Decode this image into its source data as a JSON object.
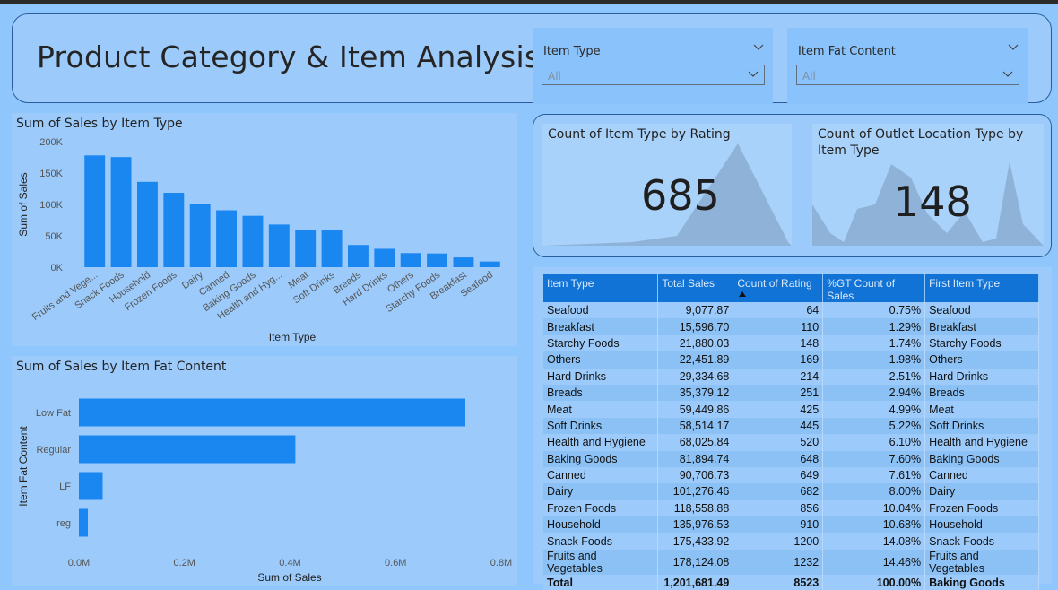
{
  "header": {
    "title": "Product Category & Item Analysis"
  },
  "slicers": [
    {
      "title": "Item Type",
      "value": "All"
    },
    {
      "title": "Item Fat Content",
      "value": "All"
    }
  ],
  "cards": [
    {
      "title": "Count of Item Type by Rating",
      "value": "685"
    },
    {
      "title": "Count of Outlet Location Type by Item Type",
      "value": "148"
    }
  ],
  "colors": {
    "bar": "#1a86f0",
    "background": "#8fc6fb",
    "panel": "#9ccbfb",
    "table_header": "#1273d6"
  },
  "chart_data": [
    {
      "type": "bar",
      "title": "Sum of Sales by Item Type",
      "xlabel": "Item Type",
      "ylabel": "Sum of Sales",
      "ylim": [
        0,
        200000
      ],
      "yticks": [
        "0K",
        "50K",
        "100K",
        "150K",
        "200K"
      ],
      "categories": [
        "Fruits and Vegetables",
        "Snack Foods",
        "Household",
        "Frozen Foods",
        "Dairy",
        "Canned",
        "Baking Goods",
        "Health and Hygiene",
        "Meat",
        "Soft Drinks",
        "Breads",
        "Hard Drinks",
        "Others",
        "Starchy Foods",
        "Breakfast",
        "Seafood"
      ],
      "tick_labels": [
        "Fruits and Vege...",
        "Snack Foods",
        "Household",
        "Frozen Foods",
        "Dairy",
        "Canned",
        "Baking Goods",
        "Health and Hyg...",
        "Meat",
        "Soft Drinks",
        "Breads",
        "Hard Drinks",
        "Others",
        "Starchy Foods",
        "Breakfast",
        "Seafood"
      ],
      "values": [
        178124.08,
        175433.92,
        135976.53,
        118558.88,
        101276.46,
        90706.73,
        81894.74,
        68025.84,
        59449.86,
        58514.17,
        35379.12,
        29334.68,
        22451.89,
        21880.03,
        15596.7,
        9077.87
      ],
      "grid": false
    },
    {
      "type": "bar",
      "orientation": "horizontal",
      "title": "Sum of Sales by Item Fat Content",
      "xlabel": "Sum of Sales",
      "ylabel": "Item Fat Content",
      "xlim": [
        0,
        800000
      ],
      "xticks": [
        "0.0M",
        "0.2M",
        "0.4M",
        "0.6M",
        "0.8M"
      ],
      "categories": [
        "Low Fat",
        "Regular",
        "LF",
        "reg"
      ],
      "values": [
        732000,
        410000,
        45000,
        17000
      ],
      "grid": false
    },
    {
      "type": "table",
      "columns": [
        "Item Type",
        "Total Sales",
        "Count of Rating",
        "%GT Count of Sales",
        "First Item Type"
      ],
      "rows": [
        [
          "Seafood",
          "9,077.87",
          "64",
          "0.75%",
          "Seafood"
        ],
        [
          "Breakfast",
          "15,596.70",
          "110",
          "1.29%",
          "Breakfast"
        ],
        [
          "Starchy Foods",
          "21,880.03",
          "148",
          "1.74%",
          "Starchy Foods"
        ],
        [
          "Others",
          "22,451.89",
          "169",
          "1.98%",
          "Others"
        ],
        [
          "Hard Drinks",
          "29,334.68",
          "214",
          "2.51%",
          "Hard Drinks"
        ],
        [
          "Breads",
          "35,379.12",
          "251",
          "2.94%",
          "Breads"
        ],
        [
          "Meat",
          "59,449.86",
          "425",
          "4.99%",
          "Meat"
        ],
        [
          "Soft Drinks",
          "58,514.17",
          "445",
          "5.22%",
          "Soft Drinks"
        ],
        [
          "Health and Hygiene",
          "68,025.84",
          "520",
          "6.10%",
          "Health and Hygiene"
        ],
        [
          "Baking Goods",
          "81,894.74",
          "648",
          "7.60%",
          "Baking Goods"
        ],
        [
          "Canned",
          "90,706.73",
          "649",
          "7.61%",
          "Canned"
        ],
        [
          "Dairy",
          "101,276.46",
          "682",
          "8.00%",
          "Dairy"
        ],
        [
          "Frozen Foods",
          "118,558.88",
          "856",
          "10.04%",
          "Frozen Foods"
        ],
        [
          "Household",
          "135,976.53",
          "910",
          "10.68%",
          "Household"
        ],
        [
          "Snack Foods",
          "175,433.92",
          "1200",
          "14.08%",
          "Snack Foods"
        ],
        [
          "Fruits and Vegetables",
          "178,124.08",
          "1232",
          "14.46%",
          "Fruits and Vegetables"
        ]
      ],
      "total": [
        "Total",
        "1,201,681.49",
        "8523",
        "100.00%",
        "Baking Goods"
      ]
    }
  ]
}
